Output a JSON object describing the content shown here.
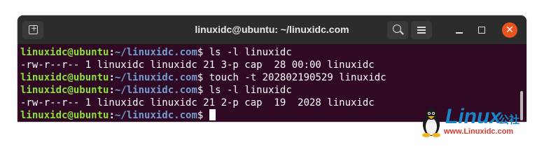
{
  "window": {
    "title": "linuxidc@ubuntu: ~/linuxidc.com"
  },
  "icons": {
    "new_tab": "new-tab-icon",
    "search": "search-icon",
    "menu": "hamburger-menu-icon",
    "minimize": "minimize-icon",
    "maximize": "maximize-icon",
    "close": "close-icon"
  },
  "colors": {
    "terminal_bg": "#300a24",
    "titlebar_bg": "#2c2c2c",
    "prompt_user": "#8ae234",
    "prompt_path": "#729fcf",
    "close_button": "#e95420",
    "watermark_blue": "#1a86c8",
    "watermark_red": "#e03a2c"
  },
  "terminal": {
    "prompt_user": "linuxidc@ubuntu",
    "prompt_sep": ":",
    "prompt_path": "~/linuxidc.com",
    "prompt_symbol": "$",
    "lines": [
      {
        "type": "command",
        "text": " ls -l linuxidc"
      },
      {
        "type": "output",
        "text": "-rw-r--r-- 1 linuxidc linuxidc 21 3-p cap  28 00:00 linuxidc"
      },
      {
        "type": "command",
        "text": " touch -t 202802190529 linuxidc"
      },
      {
        "type": "command",
        "text": " ls -l linuxidc"
      },
      {
        "type": "output",
        "text": "-rw-r--r-- 1 linuxidc linuxidc 21 2-p cap  19  2028 linuxidc"
      },
      {
        "type": "command",
        "text": " "
      }
    ]
  },
  "watermark": {
    "brand": "Linux",
    "suffix": "公社",
    "url": "www.Linuxidc.com"
  }
}
